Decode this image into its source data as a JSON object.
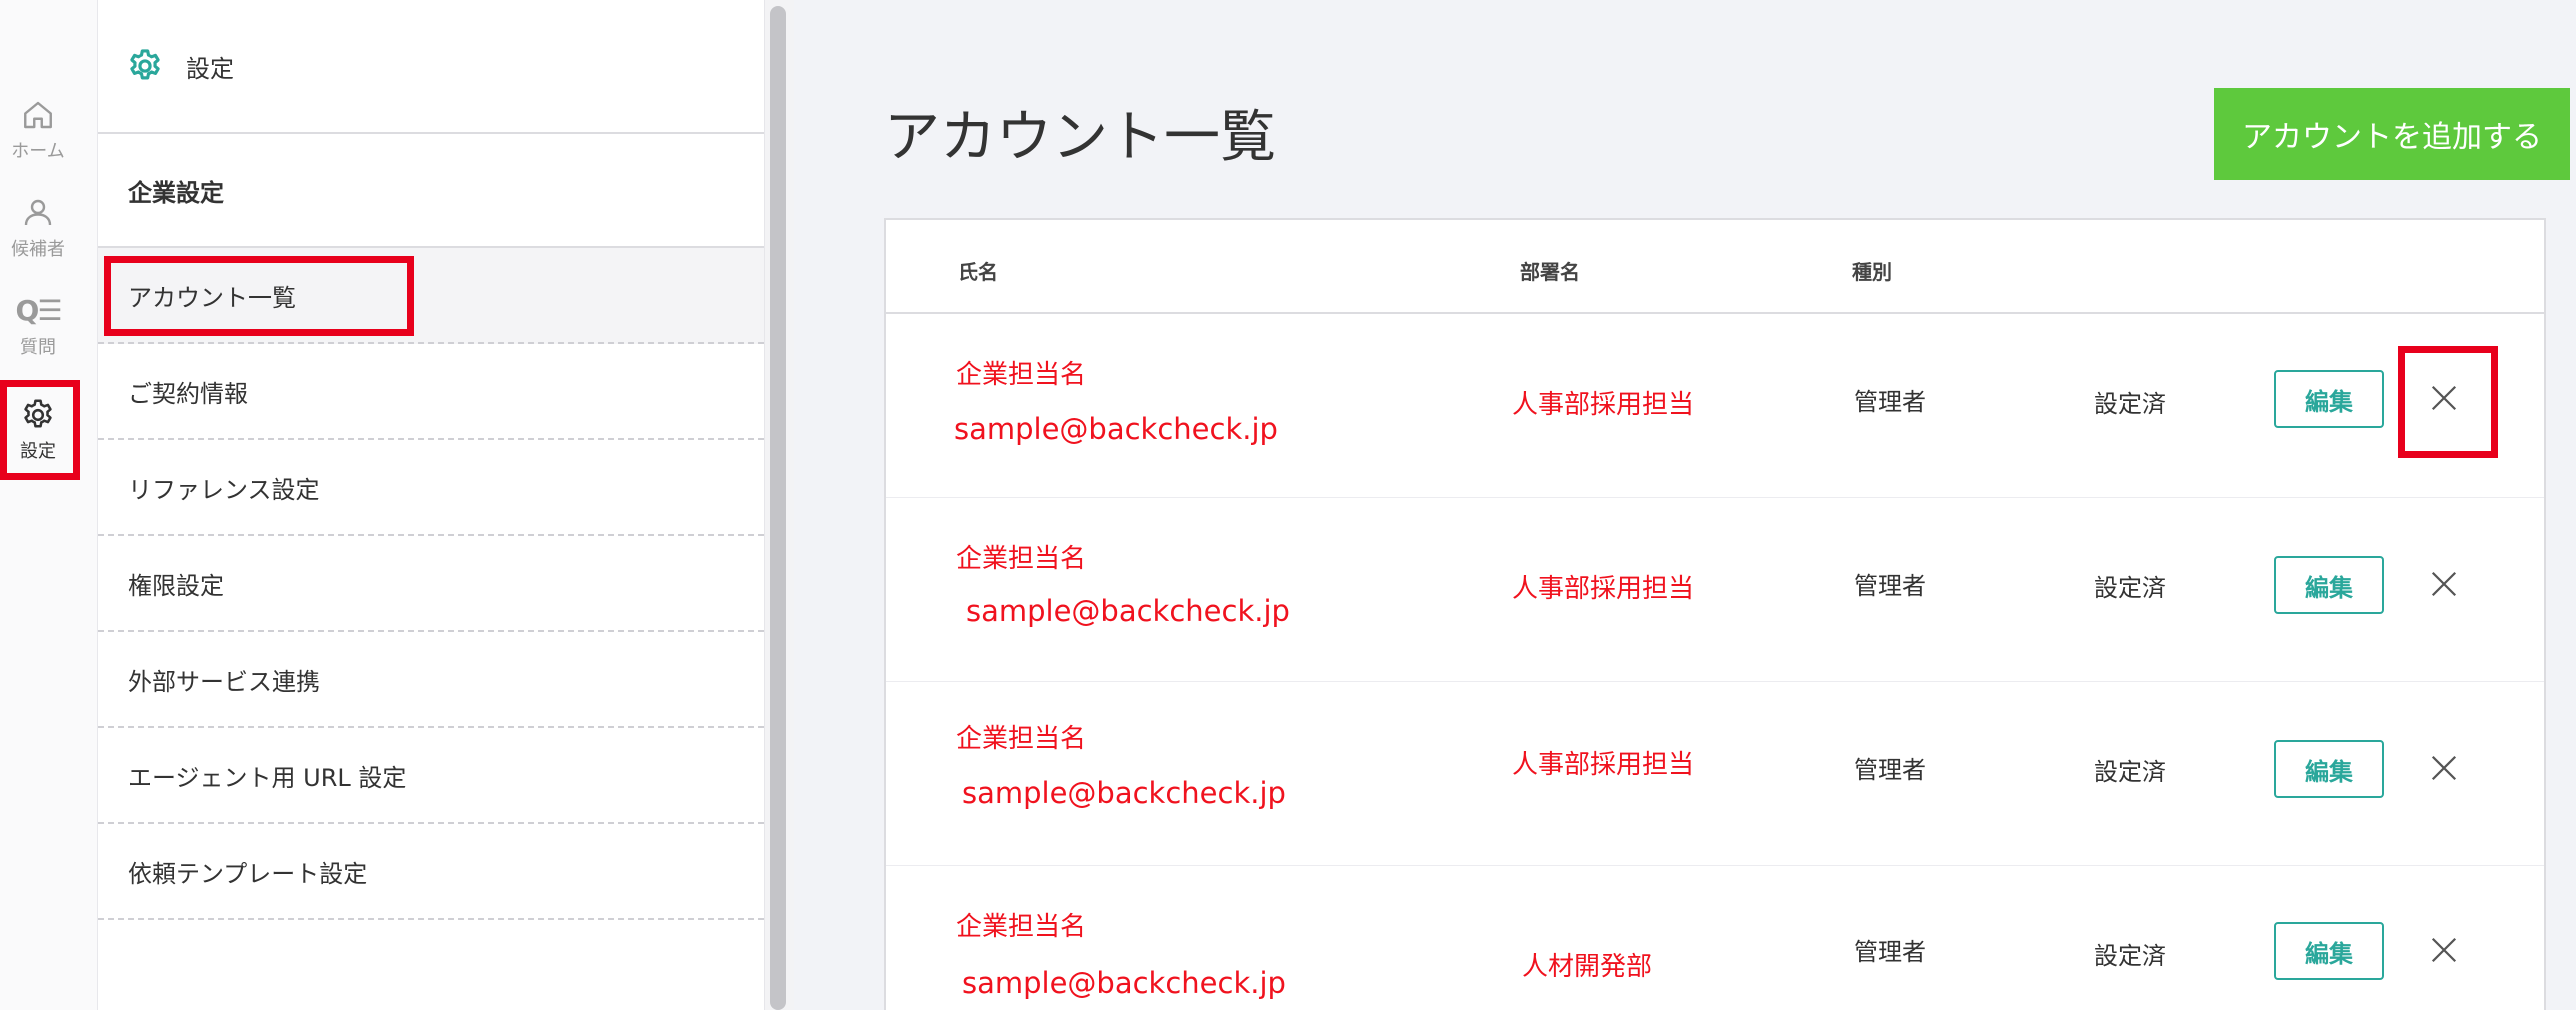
{
  "rail": {
    "items": [
      {
        "label": "ホーム",
        "icon": "home-icon"
      },
      {
        "label": "候補者",
        "icon": "person-icon"
      },
      {
        "label": "質問",
        "icon_text": "Q☰",
        "icon": "question-list-icon"
      },
      {
        "label": "設定",
        "icon": "gear-icon"
      }
    ]
  },
  "sidebar": {
    "title": "設定",
    "section": "企業設定",
    "items": [
      {
        "label": "アカウント一覧"
      },
      {
        "label": "ご契約情報"
      },
      {
        "label": "リファレンス設定"
      },
      {
        "label": "権限設定"
      },
      {
        "label": "外部サービス連携"
      },
      {
        "label": "エージェント用 URL 設定"
      },
      {
        "label": "依頼テンプレート設定"
      }
    ]
  },
  "main": {
    "title": "アカウント一覧",
    "add_button": "アカウントを追加する",
    "table": {
      "headers": {
        "name": "氏名",
        "dept": "部署名",
        "type": "種別"
      },
      "rows": [
        {
          "name": "企業担当名",
          "email": "sample@backcheck.jp",
          "dept": "人事部採用担当",
          "type": "管理者",
          "status": "設定済",
          "edit": "編集"
        },
        {
          "name": "企業担当名",
          "email": "sample@backcheck.jp",
          "dept": "人事部採用担当",
          "type": "管理者",
          "status": "設定済",
          "edit": "編集"
        },
        {
          "name": "企業担当名",
          "email": "sample@backcheck.jp",
          "dept": "人事部採用担当",
          "type": "管理者",
          "status": "設定済",
          "edit": "編集"
        },
        {
          "name": "企業担当名",
          "email": "sample@backcheck.jp",
          "dept": "人材開発部",
          "type": "管理者",
          "status": "設定済",
          "edit": "編集"
        }
      ]
    }
  },
  "colors": {
    "accent": "#2aa79b",
    "add_button": "#5ec93d",
    "highlight": "#e8001c",
    "sample_text": "#f0121e"
  }
}
